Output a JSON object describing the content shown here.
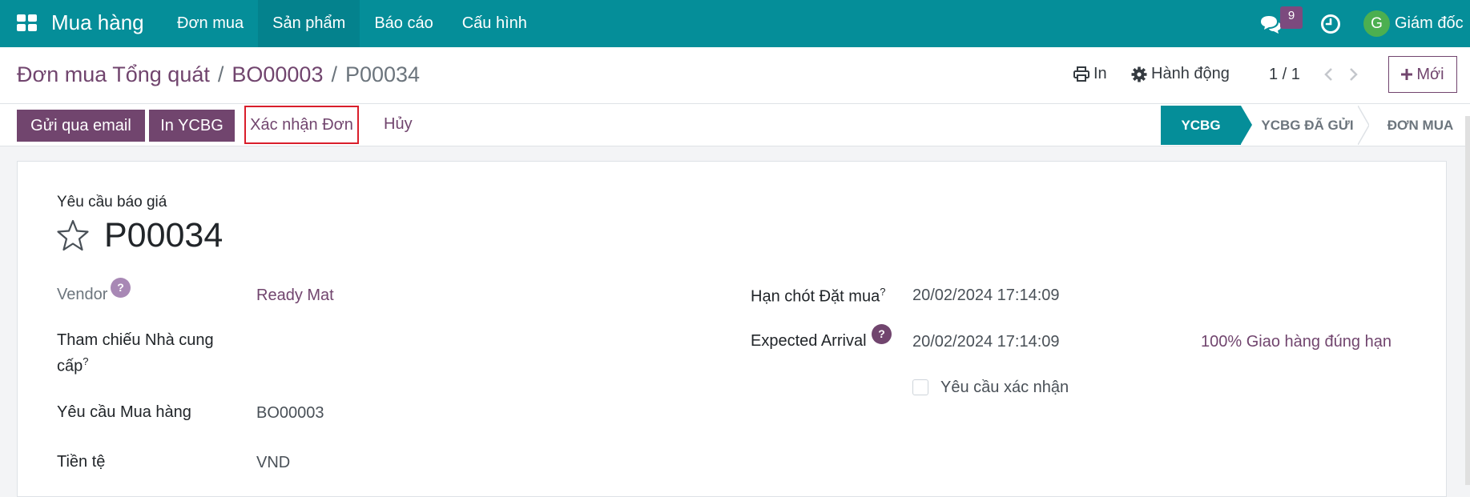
{
  "navbar": {
    "app_name": "Mua hàng",
    "menu": [
      {
        "label": "Đơn mua"
      },
      {
        "label": "Sản phẩm"
      },
      {
        "label": "Báo cáo"
      },
      {
        "label": "Cấu hình"
      }
    ],
    "chat_badge": "9",
    "user_initial": "G",
    "user_name": "Giám đốc",
    "color": "#058e99"
  },
  "control": {
    "breadcrumb": [
      "Đơn mua Tổng quát",
      "BO00003",
      "P00034"
    ],
    "separator": "/",
    "print_label": "In",
    "action_label": "Hành động",
    "pager": "1 / 1",
    "new_label": "Mới"
  },
  "statusbar": {
    "buttons": {
      "send_email": "Gửi qua email",
      "print_rfq": "In YCBG",
      "confirm": "Xác nhận Đơn",
      "cancel": "Hủy"
    },
    "stages": [
      "YCBG",
      "YCBG ĐÃ GỬI",
      "ĐƠN MUA"
    ],
    "active_stage": "YCBG"
  },
  "form": {
    "doc_label": "Yêu cầu báo giá",
    "doc_name": "P00034",
    "fields": {
      "vendor_label": "Vendor",
      "vendor_value": "Ready Mat",
      "vendor_ref_label_1": "Tham chiếu Nhà cung",
      "vendor_ref_label_2": "cấp",
      "purchase_req_label": "Yêu cầu Mua hàng",
      "purchase_req_value": "BO00003",
      "currency_label": "Tiền tệ",
      "currency_value": "VND",
      "deadline_label": "Hạn chót Đặt mua",
      "deadline_value": "20/02/2024 17:14:09",
      "expected_label": "Expected Arrival",
      "expected_value": "20/02/2024 17:14:09",
      "on_time": "100% Giao hàng đúng hạn",
      "confirm_req_label": "Yêu cầu xác nhận"
    },
    "help_mark": "?"
  },
  "colors": {
    "primary": "#71456e",
    "teal": "#058e99",
    "highlight": "#d91e2b"
  }
}
